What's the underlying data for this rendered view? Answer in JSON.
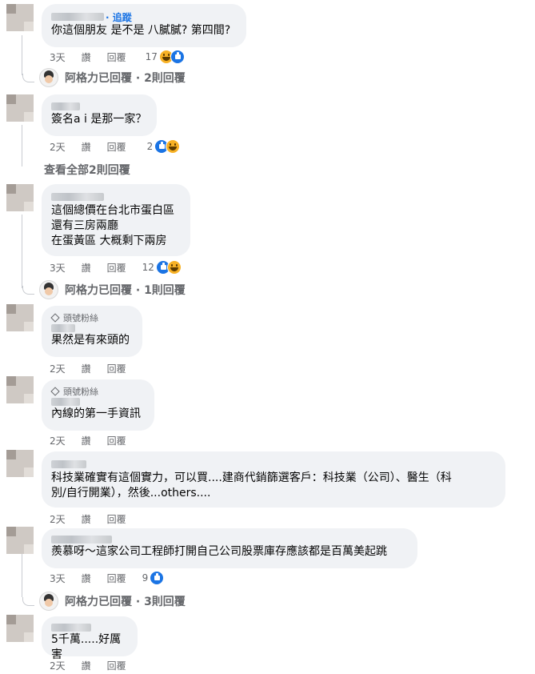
{
  "comments": [
    {
      "follow_label": "· 追蹤",
      "text": "你這個朋友 是不是 八膩膩? 第四間?",
      "time": "3天",
      "like": "讚",
      "reply": "回覆",
      "reaction_count": "17",
      "reply_summary": "阿格力已回覆 · 2則回覆"
    },
    {
      "text": "簽名a i 是那一家？",
      "time": "2天",
      "like": "讚",
      "reply": "回覆",
      "reaction_count": "2",
      "view_all": "查看全部2則回覆"
    },
    {
      "text": "這個總價在台北市蛋白區\n還有三房兩廳\n在蛋黃區 大概剩下兩房",
      "time": "3天",
      "like": "讚",
      "reply": "回覆",
      "reaction_count": "12",
      "reply_summary": "阿格力已回覆 · 1則回覆"
    },
    {
      "badge": "頭號粉絲",
      "text": "果然是有來頭的",
      "time": "2天",
      "like": "讚",
      "reply": "回覆"
    },
    {
      "badge": "頭號粉絲",
      "text": "內線的第一手資訊",
      "time": "2天",
      "like": "讚",
      "reply": "回覆"
    },
    {
      "text": "科技業確實有這個實力，可以買....建商代銷篩選客戶：科技業（公司）、醫生（科\n別/自行開業），然後...others....",
      "time": "2天",
      "like": "讚",
      "reply": "回覆"
    },
    {
      "text": "羨慕呀～這家公司工程師打開自己公司股票庫存應該都是百萬美起跳",
      "time": "3天",
      "like": "讚",
      "reply": "回覆",
      "reaction_count": "9",
      "reply_summary": "阿格力已回覆 · 3則回覆"
    },
    {
      "text": "5千萬.....好厲害",
      "time": "2天",
      "like": "讚",
      "reply": "回覆"
    }
  ],
  "colors": {
    "bubble": "#f0f2f5",
    "meta": "#65676b",
    "link": "#1b74e4"
  },
  "icons": [
    "haha-reaction-icon",
    "like-reaction-icon",
    "top-fan-badge-icon"
  ]
}
